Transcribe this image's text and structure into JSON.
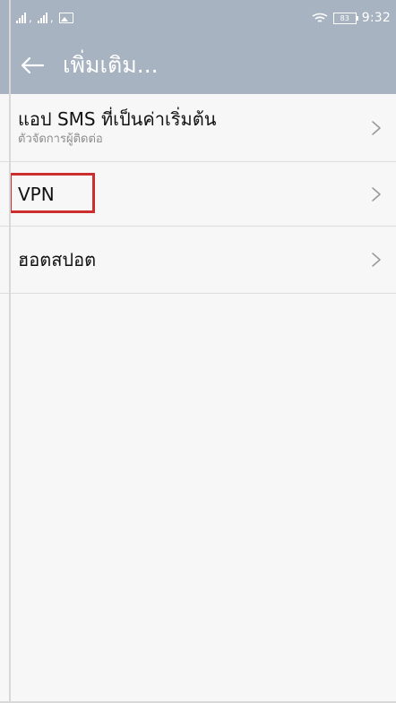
{
  "status_bar": {
    "time": "9:32",
    "battery_level": "83",
    "icons": [
      "signal-icon",
      "signal-icon",
      "image-icon",
      "wifi-icon",
      "battery-icon"
    ]
  },
  "header": {
    "title": "เพิ่มเติม...",
    "back_icon": "back-arrow-icon"
  },
  "menu": {
    "items": [
      {
        "title": "แอป SMS ที่เป็นค่าเริ่มต้น",
        "subtitle": "ตัวจัดการผู้ติดต่อ"
      },
      {
        "title": "VPN"
      },
      {
        "title": "ฮอตสปอต"
      }
    ]
  },
  "colors": {
    "header_bg": "#a7b3c1",
    "content_bg": "#f7f7f7",
    "divider": "#dddddd",
    "highlight": "#cc2e2e"
  }
}
